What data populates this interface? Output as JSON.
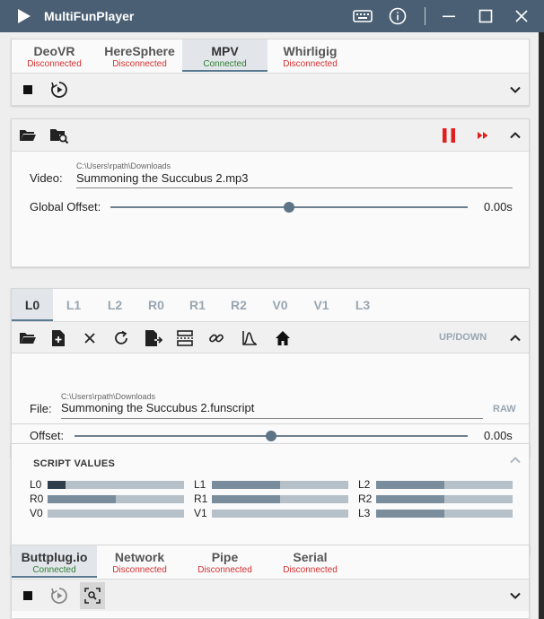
{
  "app": {
    "title": "MultiFunPlayer"
  },
  "titlebar": {
    "icons": [
      "keyboard-icon",
      "info-icon",
      "minimize-icon",
      "maximize-icon",
      "close-icon"
    ]
  },
  "video_sources": {
    "tabs": [
      {
        "label": "DeoVR",
        "status": "Disconnected"
      },
      {
        "label": "HereSphere",
        "status": "Disconnected"
      },
      {
        "label": "MPV",
        "status": "Connected"
      },
      {
        "label": "Whirligig",
        "status": "Disconnected"
      }
    ],
    "active_tab": "MPV"
  },
  "media": {
    "video_label": "Video:",
    "video_path": "C:\\Users\\rpath\\Downloads",
    "video_file": "Summoning the Succubus 2.mp3",
    "global_offset_label": "Global Offset:",
    "global_offset_value": "0.00s",
    "global_offset_position": 0.5
  },
  "axes": {
    "tabs": [
      "L0",
      "L1",
      "L2",
      "R0",
      "R1",
      "R2",
      "V0",
      "V1",
      "L3"
    ],
    "active": "L0",
    "mode_label": "UP/DOWN",
    "file_label": "File:",
    "file_path": "C:\\Users\\rpath\\Downloads",
    "file_name": "Summoning the Succubus 2.funscript",
    "raw_label": "RAW",
    "offset_label": "Offset:",
    "offset_value": "0.00s",
    "offset_position": 0.5
  },
  "script_values": {
    "title": "SCRIPT VALUES",
    "items": [
      {
        "name": "L0",
        "value": 0.13
      },
      {
        "name": "L1",
        "value": 0.5
      },
      {
        "name": "L2",
        "value": 0.5
      },
      {
        "name": "R0",
        "value": 0.5
      },
      {
        "name": "R1",
        "value": 0.5
      },
      {
        "name": "R2",
        "value": 0.5
      },
      {
        "name": "V0",
        "value": 0.0
      },
      {
        "name": "V1",
        "value": 0.0
      },
      {
        "name": "L3",
        "value": 0.5
      }
    ]
  },
  "outputs": {
    "tabs": [
      {
        "label": "Buttplug.io",
        "status": "Connected"
      },
      {
        "label": "Network",
        "status": "Disconnected"
      },
      {
        "label": "Pipe",
        "status": "Disconnected"
      },
      {
        "label": "Serial",
        "status": "Disconnected"
      }
    ],
    "active_tab": "Buttplug.io"
  },
  "colors": {
    "titlebar": "#4a5f73",
    "connected": "#2e7d32",
    "disconnected": "#d32f2f",
    "accent_red": "#e0201e",
    "heat_yellow": "#efcf6a",
    "heat_orange": "#f09a40"
  }
}
